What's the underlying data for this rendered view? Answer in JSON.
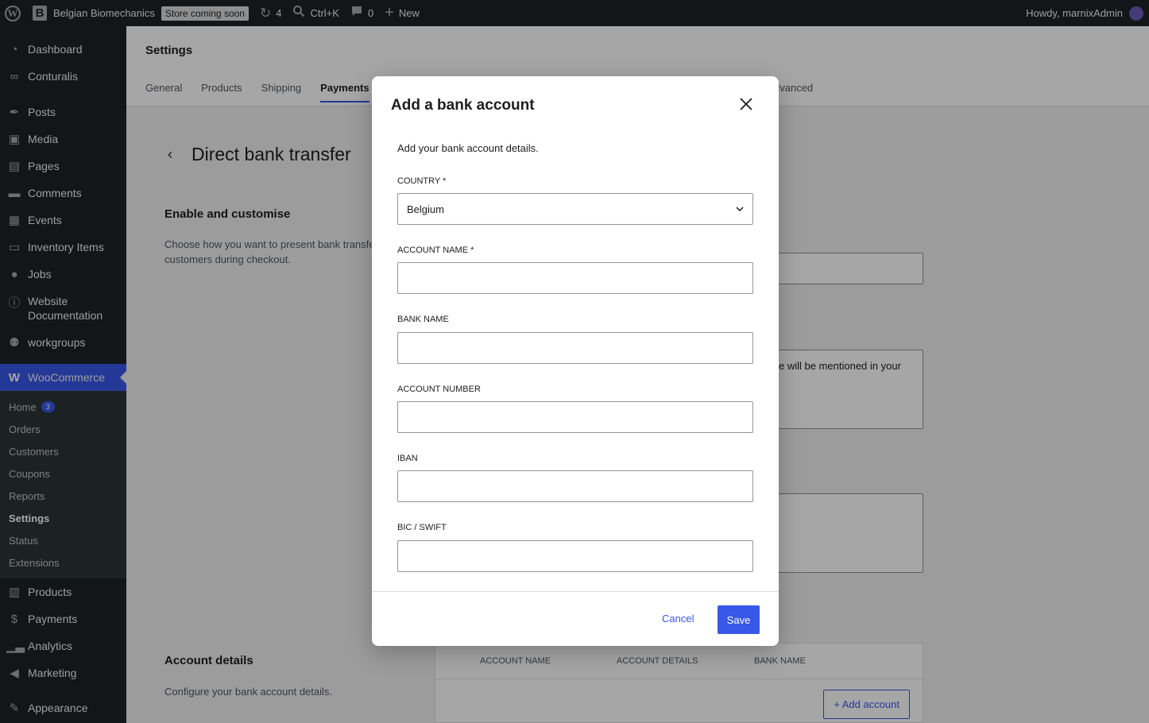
{
  "adminbar": {
    "site_name": "Belgian Biomechanics",
    "store_badge": "Store coming soon",
    "updates_count": "4",
    "search_shortcut": "Ctrl+K",
    "comments_count": "0",
    "new_label": "New",
    "howdy": "Howdy, marnixAdmin"
  },
  "sidebar": {
    "items": [
      {
        "label": "Dashboard",
        "icon": "dashboard-icon"
      },
      {
        "label": "Conturalis",
        "icon": "conturalis-icon"
      },
      {
        "label": "Posts",
        "icon": "pin-icon"
      },
      {
        "label": "Media",
        "icon": "media-icon"
      },
      {
        "label": "Pages",
        "icon": "pages-icon"
      },
      {
        "label": "Comments",
        "icon": "comment-icon"
      },
      {
        "label": "Events",
        "icon": "calendar-icon"
      },
      {
        "label": "Inventory Items",
        "icon": "folder-icon"
      },
      {
        "label": "Jobs",
        "icon": "person-icon"
      },
      {
        "label": "Website Documentation",
        "icon": "info-icon"
      },
      {
        "label": "workgroups",
        "icon": "groups-icon"
      },
      {
        "label": "WooCommerce",
        "icon": "woo-icon"
      }
    ],
    "woo_submenu": [
      {
        "label": "Home",
        "badge": "3"
      },
      {
        "label": "Orders"
      },
      {
        "label": "Customers"
      },
      {
        "label": "Coupons"
      },
      {
        "label": "Reports"
      },
      {
        "label": "Settings"
      },
      {
        "label": "Status"
      },
      {
        "label": "Extensions"
      }
    ],
    "bottom_items": [
      {
        "label": "Products",
        "icon": "box-icon"
      },
      {
        "label": "Payments",
        "icon": "dollar-icon"
      },
      {
        "label": "Analytics",
        "icon": "chart-icon"
      },
      {
        "label": "Marketing",
        "icon": "megaphone-icon"
      },
      {
        "label": "Appearance",
        "icon": "brush-icon"
      }
    ]
  },
  "settings": {
    "title": "Settings",
    "tabs": [
      "General",
      "Products",
      "Shipping",
      "Payments"
    ],
    "tab_partial_advanced": "dvanced",
    "page_title": "Direct bank transfer",
    "enable_title": "Enable and customise",
    "enable_desc": "Choose how you want to present bank transfe customers during checkout.",
    "partial_text": "e will be mentioned in your",
    "account_title": "Account details",
    "account_desc": "Configure your bank account details.",
    "table_headers": [
      "ACCOUNT NAME",
      "ACCOUNT DETAILS",
      "BANK NAME"
    ],
    "add_account": "+ Add account"
  },
  "modal": {
    "title": "Add a bank account",
    "description": "Add your bank account details.",
    "country_label": "COUNTRY *",
    "country_value": "Belgium",
    "account_name_label": "ACCOUNT NAME *",
    "bank_name_label": "BANK NAME",
    "account_number_label": "ACCOUNT NUMBER",
    "iban_label": "IBAN",
    "bic_label": "BIC / SWIFT",
    "cancel": "Cancel",
    "save": "Save"
  },
  "colors": {
    "accent": "#3858e9",
    "admin_bg": "#1d2327"
  }
}
